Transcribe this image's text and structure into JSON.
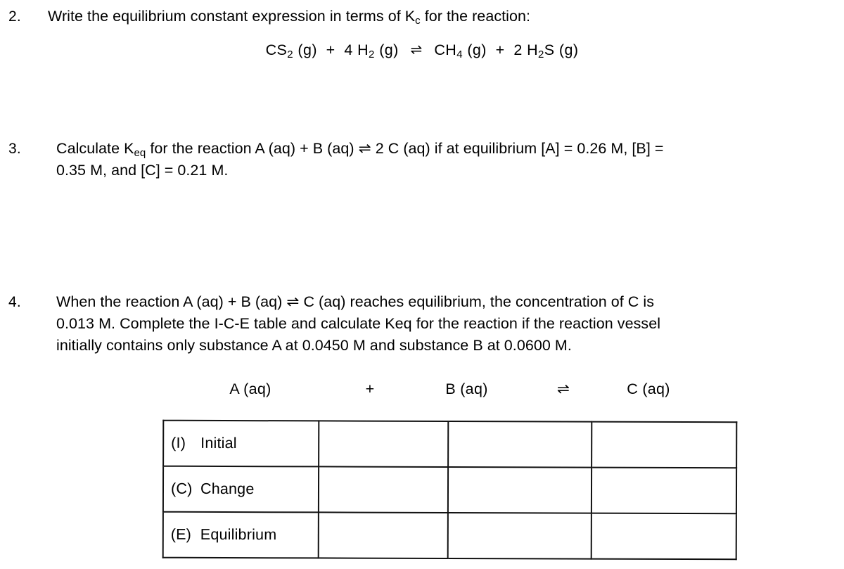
{
  "worksheet": {
    "questions": [
      {
        "number": "2.",
        "lines": [
          "Write the equilibrium constant expression in terms of K",
          "c",
          " for the reaction:"
        ],
        "text_before_sub": "Write the equilibrium constant expression in terms of K",
        "subscript": "c",
        "text_after_sub": " for the reaction:",
        "equation": {
          "reactant1": "CS",
          "reactant1_sub": "2",
          "reactant1_state": "(g)",
          "plus1": "+",
          "reactant2_coeff": "4",
          "reactant2": "H",
          "reactant2_sub": "2",
          "reactant2_state": "(g)",
          "arrow": "⇌",
          "product1": "CH",
          "product1_sub": "4",
          "product1_state": "(g)",
          "plus2": "+",
          "product2_coeff": "2",
          "product2": "H",
          "product2_sub": "2",
          "product2_tail": "S",
          "product2_state": "(g)"
        }
      },
      {
        "number": "3.",
        "line1_a": "Calculate K",
        "line1_sub": "eq",
        "line1_b": " for the reaction A (aq)  +  B (aq)   ⇌   2 C (aq) if at equilibrium [A] = 0.26 M, [B] =",
        "line2": "0.35 M, and [C] = 0.21 M.",
        "values": {
          "A": "0.26 M",
          "B": "0.35 M",
          "C": "0.21 M"
        }
      },
      {
        "number": "4.",
        "line1": "When the reaction A (aq)  +  B (aq)   ⇌   C (aq) reaches equilibrium, the concentration of C is",
        "line2": "0.013 M. Complete the I-C-E table and calculate Keq for the reaction if the reaction vessel",
        "line3": "initially contains only substance A at 0.0450 M and substance B at 0.0600 M.",
        "values": {
          "C_equilibrium": "0.013 M",
          "A_initial": "0.0450 M",
          "B_initial": "0.0600 M"
        }
      }
    ]
  },
  "ice_table": {
    "header": {
      "species_a": "A (aq)",
      "plus": "+",
      "species_b": "B (aq)",
      "arrow": "⇌",
      "species_c": "C (aq)"
    },
    "rows": [
      {
        "tag": "(I)",
        "label": "Initial",
        "cell_a": "",
        "cell_b": "",
        "cell_c": ""
      },
      {
        "tag": "(C)",
        "label": "Change",
        "cell_a": "",
        "cell_b": "",
        "cell_c": ""
      },
      {
        "tag": "(E)",
        "label": "Equilibrium",
        "cell_a": "",
        "cell_b": "",
        "cell_c": ""
      }
    ]
  }
}
